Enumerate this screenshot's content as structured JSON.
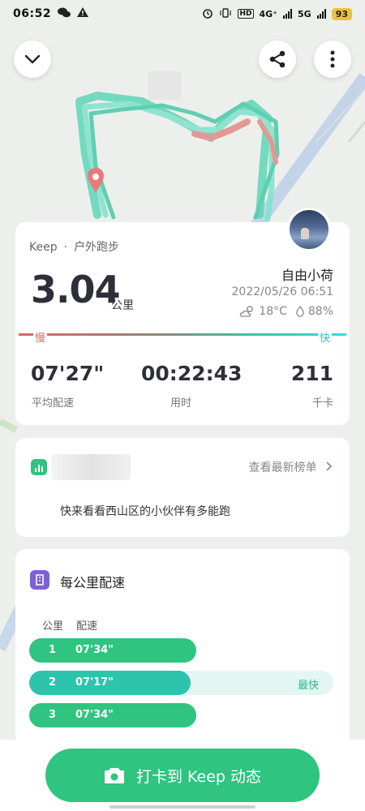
{
  "status_bar": {
    "time": "06:52",
    "network1": "4G⁺",
    "network2": "5G",
    "battery": "93"
  },
  "summary": {
    "brand": "Keep",
    "dot": "·",
    "activity": "户外跑步",
    "username": "自由小荷",
    "distance": "3.04",
    "distance_unit": "公里",
    "datetime": "2022/05/26  06:51",
    "temperature": "18°C",
    "humidity": "88%",
    "slow_label": "慢",
    "fast_label": "快",
    "stats": [
      {
        "value": "07'27\"",
        "label": "平均配速"
      },
      {
        "value": "00:22:43",
        "label": "用时"
      },
      {
        "value": "211",
        "label": "千卡"
      }
    ]
  },
  "rank": {
    "link": "查看最新榜单",
    "text": "快来看看西山区的小伙伴有多能跑"
  },
  "pace": {
    "title": "每公里配速",
    "col_km": "公里",
    "col_pace": "配速",
    "fastest_label": "最快",
    "rows": [
      {
        "km": "1",
        "pace": "07'34\"",
        "fraction": 0.55
      },
      {
        "km": "2",
        "pace": "07'17\"",
        "fraction": 0.53,
        "fastest": true
      },
      {
        "km": "3",
        "pace": "07'34\"",
        "fraction": 0.55
      }
    ]
  },
  "checkin": {
    "label": "打卡到 Keep 动态"
  },
  "colors": {
    "accent": "#2fc47f",
    "slow": "#e06464",
    "fast": "#2fc2c2",
    "pace_icon": "#7b61d9"
  }
}
